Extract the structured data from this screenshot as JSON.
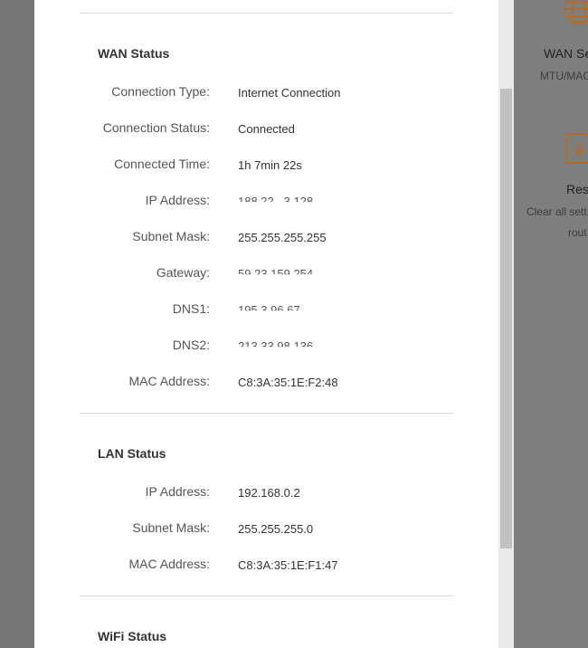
{
  "background": {
    "cards": [
      {
        "title": "WAN Se",
        "subtitle": "MTU/MAC"
      },
      {
        "title": "Res",
        "subtitle_line1": "Clear all sett",
        "subtitle_line2": "rout"
      }
    ]
  },
  "wan_status": {
    "title": "WAN Status",
    "rows": [
      {
        "label": "Connection Type:",
        "value": "Internet Connection"
      },
      {
        "label": "Connection Status:",
        "value": "Connected"
      },
      {
        "label": "Connected Time:",
        "value": "1h 7min 22s"
      },
      {
        "label": "IP Address:",
        "value": "188.22.  .3.128"
      },
      {
        "label": "Subnet Mask:",
        "value": "255.255.255.255"
      },
      {
        "label": "Gateway:",
        "value": "  59.23.159.254"
      },
      {
        "label": "DNS1:",
        "value": "195.3.96.67"
      },
      {
        "label": "DNS2:",
        "value": "213.33.98.136"
      },
      {
        "label": "MAC Address:",
        "value": "C8:3A:35:1E:F2:48"
      }
    ]
  },
  "lan_status": {
    "title": "LAN Status",
    "rows": [
      {
        "label": "IP Address:",
        "value": "192.168.0.2"
      },
      {
        "label": "Subnet Mask:",
        "value": "255.255.255.0"
      },
      {
        "label": "MAC Address:",
        "value": "C8:3A:35:1E:F1:47"
      }
    ]
  },
  "wifi_status": {
    "title": "WiFi Status"
  },
  "colors": {
    "accent_icon": "#c8823a"
  }
}
